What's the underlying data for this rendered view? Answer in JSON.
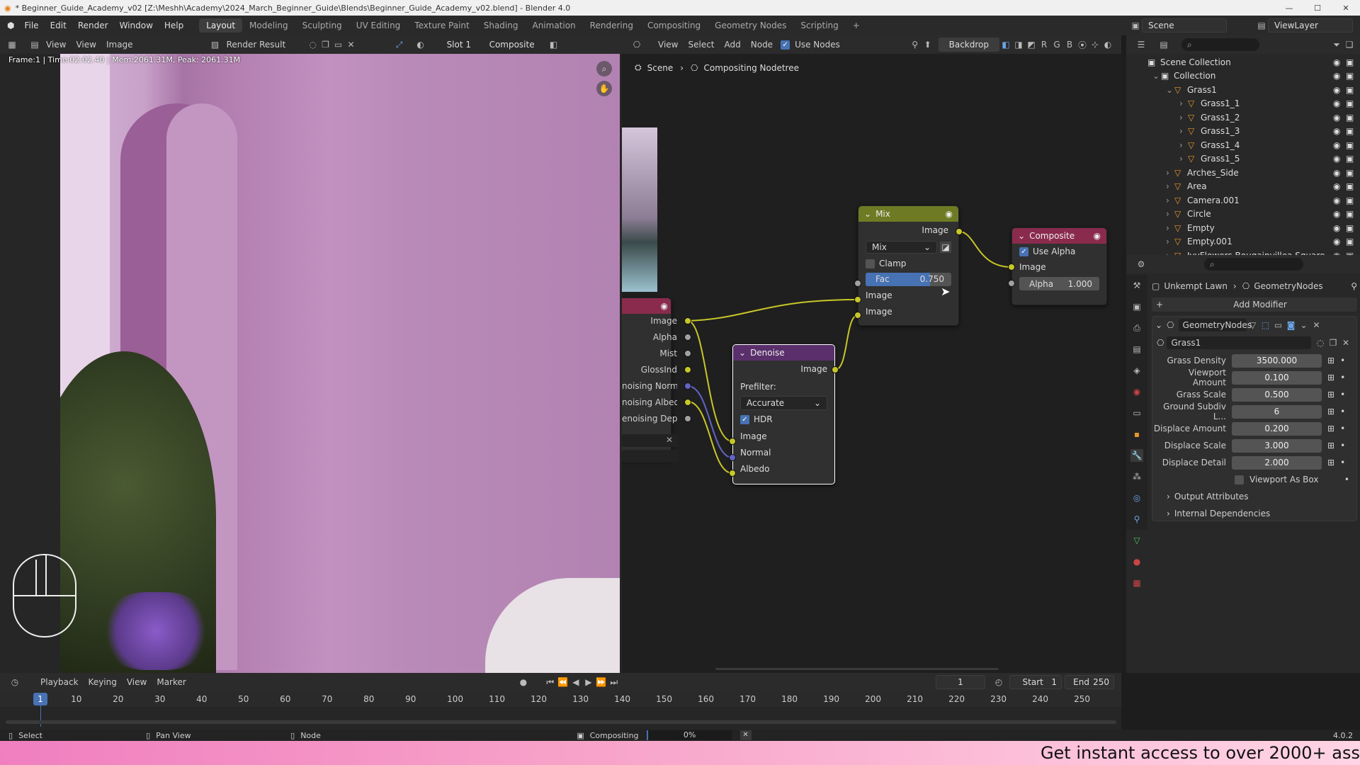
{
  "titlebar": {
    "title": "* Beginner_Guide_Academy_v02 [Z:\\Meshh\\Academy\\2024_March_Beginner_Guide\\Blends\\Beginner_Guide_Academy_v02.blend] - Blender 4.0"
  },
  "menubar": {
    "menus": [
      "File",
      "Edit",
      "Render",
      "Window",
      "Help"
    ],
    "workspaces": [
      "Layout",
      "Modeling",
      "Sculpting",
      "UV Editing",
      "Texture Paint",
      "Shading",
      "Animation",
      "Rendering",
      "Compositing",
      "Geometry Nodes",
      "Scripting"
    ],
    "active_workspace": "Layout",
    "add_ws": "+",
    "scene": "Scene",
    "view_layer": "ViewLayer"
  },
  "image_editor": {
    "header": {
      "view": "View",
      "view2": "View",
      "image": "Image",
      "render_result": "Render Result",
      "slot": "Slot 1",
      "composite": "Composite"
    },
    "overlay": "Frame:1 | Time:02:02.40 | Mem:2061.31M, Peak: 2061.31M"
  },
  "node_editor": {
    "header": {
      "view": "View",
      "select": "Select",
      "add": "Add",
      "node": "Node",
      "use_nodes": "Use Nodes",
      "backdrop": "Backdrop",
      "channels": [
        "R",
        "G",
        "B"
      ]
    },
    "breadcrumb": {
      "scene": "Scene",
      "tree": "Compositing Nodetree"
    },
    "render_layers": {
      "outputs": [
        "Image",
        "Alpha",
        "Mist",
        "GlossInd",
        "noising Normal",
        "noising Albedo",
        "enoising Depth"
      ]
    },
    "denoise": {
      "title": "Denoise",
      "output": "Image",
      "prefilter_label": "Prefilter:",
      "prefilter": "Accurate",
      "hdr": "HDR",
      "inputs": [
        "Image",
        "Normal",
        "Albedo"
      ]
    },
    "mix": {
      "title": "Mix",
      "output": "Image",
      "mode": "Mix",
      "clamp": "Clamp",
      "fac_label": "Fac",
      "fac": "0.750",
      "fac_fraction": 0.75,
      "inputs": [
        "Image",
        "Image"
      ]
    },
    "composite": {
      "title": "Composite",
      "use_alpha": "Use Alpha",
      "input": "Image",
      "alpha_label": "Alpha",
      "alpha": "1.000"
    }
  },
  "outliner": {
    "rows": [
      {
        "label": "Scene Collection",
        "indent": 0
      },
      {
        "label": "Collection",
        "indent": 1
      },
      {
        "label": "Grass1",
        "indent": 2
      },
      {
        "label": "Grass1_1",
        "indent": 3
      },
      {
        "label": "Grass1_2",
        "indent": 3
      },
      {
        "label": "Grass1_3",
        "indent": 3
      },
      {
        "label": "Grass1_4",
        "indent": 3
      },
      {
        "label": "Grass1_5",
        "indent": 3
      },
      {
        "label": "Arches_Side",
        "indent": 2
      },
      {
        "label": "Area",
        "indent": 2
      },
      {
        "label": "Camera.001",
        "indent": 2
      },
      {
        "label": "Circle",
        "indent": 2
      },
      {
        "label": "Empty",
        "indent": 2
      },
      {
        "label": "Empty.001",
        "indent": 2
      },
      {
        "label": "IvyFlowers Bougainvillea Square",
        "indent": 2
      }
    ]
  },
  "properties": {
    "breadcrumb": {
      "object": "Unkempt Lawn",
      "modifier": "GeometryNodes"
    },
    "add_modifier": "Add Modifier",
    "modifier_name": "GeometryNodes",
    "node_group": "Grass1",
    "fields": [
      {
        "label": "Grass Density",
        "value": "3500.000"
      },
      {
        "label": "Viewport Amount",
        "value": "0.100"
      },
      {
        "label": "Grass Scale",
        "value": "0.500"
      },
      {
        "label": "Ground Subdiv L...",
        "value": "6"
      },
      {
        "label": "Displace Amount",
        "value": "0.200"
      },
      {
        "label": "Displace Scale",
        "value": "3.000"
      },
      {
        "label": "Displace Detail",
        "value": "2.000"
      }
    ],
    "viewport_as_box": "Viewport As Box",
    "panels": [
      "Output Attributes",
      "Internal Dependencies"
    ]
  },
  "timeline": {
    "menus": [
      "Playback",
      "Keying",
      "View",
      "Marker"
    ],
    "current_frame": "1",
    "start_label": "Start",
    "start": "1",
    "end_label": "End",
    "end": "250",
    "ticks": [
      "10",
      "20",
      "30",
      "40",
      "50",
      "60",
      "70",
      "80",
      "90",
      "100",
      "110",
      "120",
      "130",
      "140",
      "150",
      "160",
      "170",
      "180",
      "190",
      "200",
      "210",
      "220",
      "230",
      "240",
      "250"
    ],
    "playhead": "1"
  },
  "statusbar": {
    "select": "Select",
    "pan": "Pan View",
    "node": "Node",
    "job": "Compositing",
    "progress": "0%",
    "version": "4.0.2"
  },
  "banner": {
    "text": "Get instant access to over 2000+ ass"
  }
}
